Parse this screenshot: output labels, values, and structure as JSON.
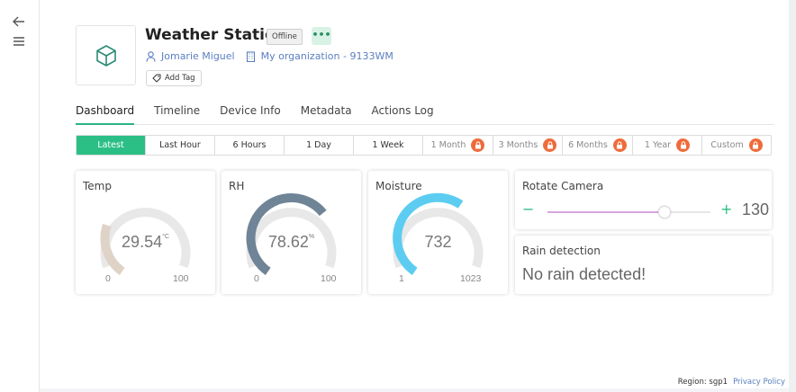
{
  "device": {
    "name": "Weather Station",
    "status": "Offline",
    "owner": "Jomarie Miguel",
    "organization": "My organization - 9133WM",
    "add_tag_label": "Add Tag"
  },
  "tabs": [
    "Dashboard",
    "Timeline",
    "Device Info",
    "Metadata",
    "Actions Log"
  ],
  "active_tab": "Dashboard",
  "time_ranges": [
    {
      "label": "Latest",
      "active": true,
      "locked": false
    },
    {
      "label": "Last Hour",
      "active": false,
      "locked": false
    },
    {
      "label": "6 Hours",
      "active": false,
      "locked": false
    },
    {
      "label": "1 Day",
      "active": false,
      "locked": false
    },
    {
      "label": "1 Week",
      "active": false,
      "locked": false
    },
    {
      "label": "1 Month",
      "active": false,
      "locked": true
    },
    {
      "label": "3 Months",
      "active": false,
      "locked": true
    },
    {
      "label": "6 Months",
      "active": false,
      "locked": true
    },
    {
      "label": "1 Year",
      "active": false,
      "locked": true
    },
    {
      "label": "Custom",
      "active": false,
      "locked": true
    }
  ],
  "widgets": {
    "temp": {
      "title": "Temp",
      "value": "29.54",
      "unit": "°C",
      "min": "0",
      "max": "100",
      "color": "#dfd3c8"
    },
    "rh": {
      "title": "RH",
      "value": "78.62",
      "unit": "%",
      "min": "0",
      "max": "100",
      "color": "#6f8497"
    },
    "moisture": {
      "title": "Moisture",
      "value": "732",
      "unit": "",
      "min": "1",
      "max": "1023",
      "color": "#5ccdf1"
    },
    "camera": {
      "title": "Rotate Camera",
      "value": "130",
      "minus": "−",
      "plus": "+",
      "slider_fraction": 0.72,
      "color": "#d7a6e0"
    },
    "rain": {
      "title": "Rain detection",
      "text": "No rain detected!"
    }
  },
  "footer": {
    "region": "Region: sgp1",
    "privacy": "Privacy Policy"
  },
  "colors": {
    "accent": "#2cbf85",
    "link": "#5a7fc0",
    "lock": "#ef6b3b"
  }
}
